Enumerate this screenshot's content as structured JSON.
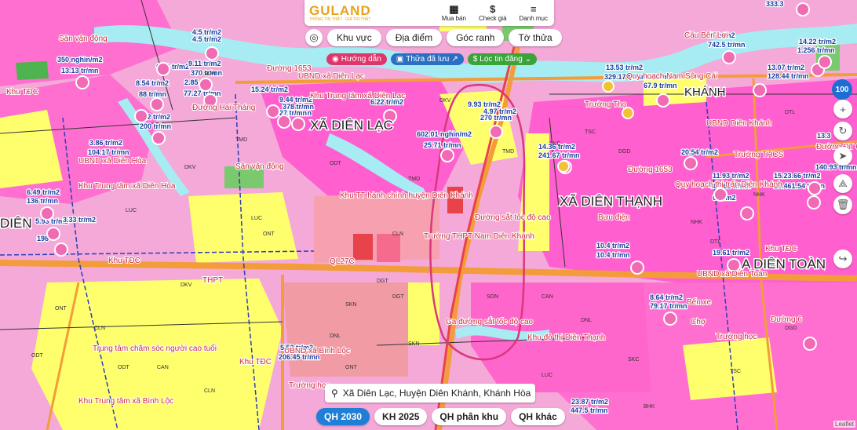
{
  "app": {
    "logo": "GULAND",
    "logo_sub": "THÔNG TIN THẬT · GIÁ TRỊ THẬT",
    "top_menu": [
      {
        "label": "Mua bán",
        "icon": "building-icon"
      },
      {
        "label": "Check giá",
        "icon": "dollar-icon"
      },
      {
        "label": "Danh mục",
        "icon": "menu-icon"
      }
    ]
  },
  "filters": {
    "buttons": [
      "Khu vực",
      "Địa điểm",
      "Góc ranh",
      "Tờ thửa"
    ],
    "chips": [
      {
        "label": "Hướng dẫn",
        "color": "#e0356b"
      },
      {
        "label": "Thửa đã lưu",
        "color": "#2b6fc4"
      },
      {
        "label": "Lọc tin đăng",
        "color": "#3aa33a"
      }
    ]
  },
  "controls": {
    "zoom": "100"
  },
  "address": "Xã Diên Lạc, Huyện Diên Khánh, Khánh Hòa",
  "bottom_tabs": [
    "QH 2030",
    "KH 2025",
    "QH phân khu",
    "QH khác"
  ],
  "attribution": "Leaflet",
  "colors": {
    "residential": "#f2a7d6",
    "rural": "#ff66cc",
    "agri": "#ffff70",
    "water": "#9fe7f0",
    "road": "#f39c3a",
    "accent": "#1f7fd6"
  },
  "map": {
    "places": [
      {
        "text": "XÃ DIÊN LẠC",
        "size": 17
      },
      {
        "text": "XÃ DIÊN THẠNH",
        "size": 17
      },
      {
        "text": "A DIÊN TOÀN",
        "size": 17
      },
      {
        "text": "DIÊN",
        "size": 17
      },
      {
        "text": "KHÁNH",
        "size": 15
      }
    ],
    "labels": [
      "Sân vận động",
      "Khu TĐC",
      "UBND xã Diên Lạc",
      "Đường 1653",
      "Khu Trung tâm xã Diên Lạc",
      "UBND xã Diên Hòa",
      "Khu Trung tâm xã Diên Hòa",
      "Sân vận động",
      "Khu TT hành chính huyện Diên Khánh",
      "Trường THPT Nam Diên Khánh",
      "QL27C",
      "Khu TĐC",
      "Ga đường sắt tốc độ cao",
      "Khu đô thị Diên Thạnh",
      "Bưu điện",
      "Trung tâm chăm sóc người cao tuổi",
      "UBND xã Bình Lộc",
      "Khu Trung tâm xã Bình Lộc",
      "Khu TĐC",
      "Trường học",
      "UBND xã Diên Toàn",
      "Bến xe",
      "Chợ",
      "Trường học",
      "Quy hoạch thị trấn Diên Khánh",
      "Trường THCS",
      "Trường Thọ",
      "Quy hoạch Nam Sông Cái",
      "UBND Diên Khánh",
      "Cầu Bến Lợi",
      "Đường 1653",
      "Đường ĐT 6",
      "Đường sắt tốc độ cao",
      "Đường Hai Tháng",
      "Khu TĐC",
      "Đường 6",
      "THPT"
    ],
    "codes": [
      "LUC",
      "ONT",
      "ODT",
      "CLN",
      "DKV",
      "TMD",
      "SKC",
      "TSC",
      "DGD",
      "BHK",
      "NHK",
      "DTL",
      "SON",
      "CAN",
      "DGT",
      "SKN",
      "DNL"
    ],
    "prices": [
      "4.5 tr/m2",
      "4.5 tr/m2",
      "350 nghìn/m2",
      "13.13 tr/mn",
      "6.93 tr/m2",
      "9.11 tr/m2",
      "370 tr/mn",
      "8.54 tr/m2",
      "2.85",
      "88 tr/mn",
      "77.27 tr/mn",
      "7.2 tr/m2",
      "200 tr/mn",
      "15.24 tr/m2",
      "27 tr/mn",
      "9.44 tr/m2",
      "378 tr/mn",
      "27 tr/mn",
      "6.22 tr/m2",
      "9.93 tr/m2",
      "4.97 tr/m2",
      "270 tr/mn",
      "602.01 nghìn/m2",
      "25.71 tr/mn",
      "14.36 tr/m2",
      "241.67 tr/mn",
      "3.86 tr/m2",
      "104.17 tr/mn",
      "6.49 tr/m2",
      "136 tr/mn",
      "5.93 tr/m2",
      "198",
      "10.4 tr/m2",
      "10.4 tr/mn",
      "19.61 tr/m2",
      "8.64 tr/m2",
      "79.17 tr/mn",
      "5.52 tr/m2",
      "206.45 tr/mn",
      "23.87 tr/m2",
      "447.5 tr/mn",
      "13.53 tr/m2",
      "329.17 tr/mn",
      ".57 tr/m2",
      "67.9 tr/mn",
      "13.07 tr/m2",
      "128.44 tr/mn",
      "14.22 tr/m2",
      "1.256 tr/mn",
      "27 tr/m2",
      "742.5 tr/mn",
      "333.3",
      "20.54 tr/m2",
      "11.93 tr/m2",
      "484.62 tr/mn",
      "15.23.66 tr/m2",
      "28.461.54 tr/mn",
      "13.3",
      "140.93 tr/mn",
      "3.33 tr/m2",
      "6 tr/m2"
    ]
  }
}
